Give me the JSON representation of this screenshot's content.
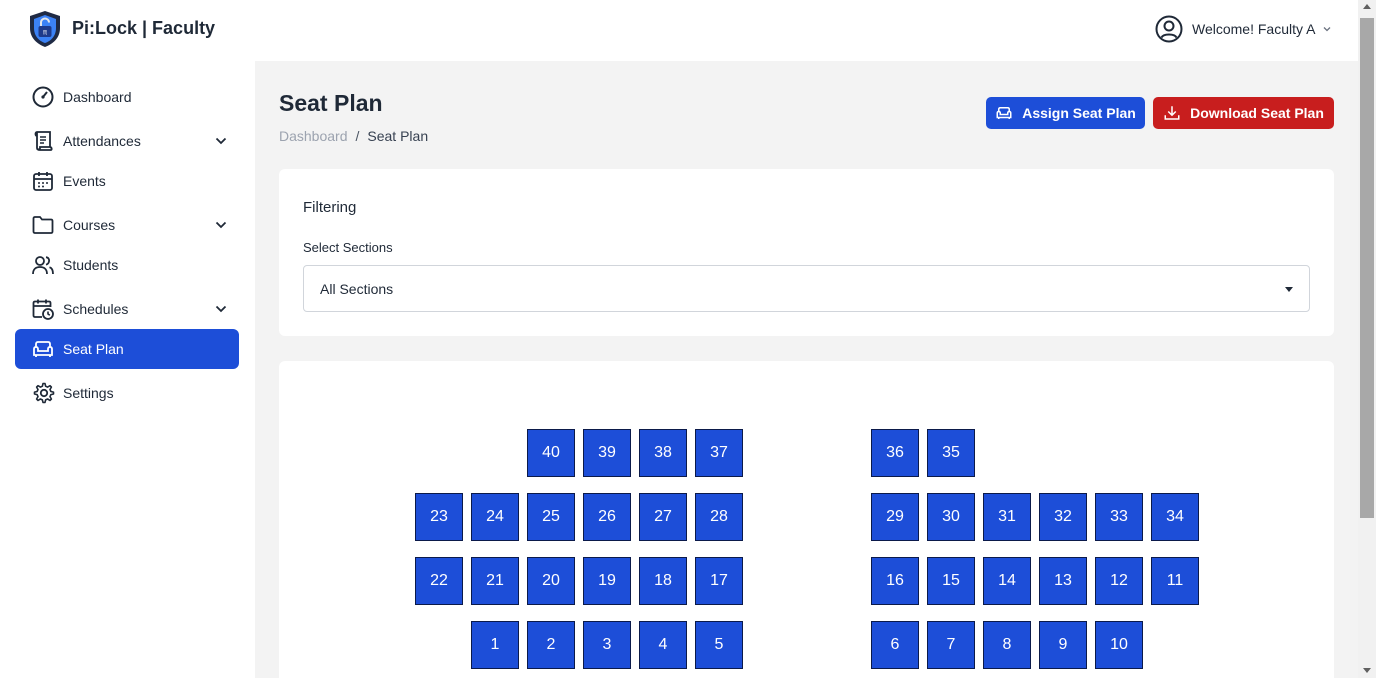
{
  "header": {
    "brand": "Pi:Lock | Faculty",
    "logo_icon": "shield-lock-icon",
    "user_icon": "user-circle-icon",
    "welcome": "Welcome! Faculty A"
  },
  "sidebar": {
    "items": [
      {
        "label": "Dashboard",
        "icon": "dashboard-gauge-icon",
        "expandable": false,
        "active": false
      },
      {
        "label": "Attendances",
        "icon": "scroll-icon",
        "expandable": true,
        "active": false
      },
      {
        "label": "Events",
        "icon": "calendar-icon",
        "expandable": false,
        "active": false
      },
      {
        "label": "Courses",
        "icon": "folder-icon",
        "expandable": true,
        "active": false
      },
      {
        "label": "Students",
        "icon": "users-icon",
        "expandable": false,
        "active": false
      },
      {
        "label": "Schedules",
        "icon": "calendar-clock-icon",
        "expandable": true,
        "active": false
      },
      {
        "label": "Seat Plan",
        "icon": "sofa-icon",
        "expandable": false,
        "active": true
      },
      {
        "label": "Settings",
        "icon": "gear-icon",
        "expandable": false,
        "active": false
      }
    ]
  },
  "page": {
    "title": "Seat Plan",
    "breadcrumb": {
      "parent": "Dashboard",
      "separator": "/",
      "current": "Seat Plan"
    },
    "buttons": {
      "assign": "Assign Seat Plan",
      "download": "Download Seat Plan"
    }
  },
  "filter": {
    "title": "Filtering",
    "label": "Select Sections",
    "selected": "All Sections"
  },
  "seats": {
    "left_rows": [
      [
        "",
        "",
        "40",
        "39",
        "38",
        "37"
      ],
      [
        "23",
        "24",
        "25",
        "26",
        "27",
        "28"
      ],
      [
        "22",
        "21",
        "20",
        "19",
        "18",
        "17"
      ],
      [
        "",
        "1",
        "2",
        "3",
        "4",
        "5"
      ]
    ],
    "right_rows": [
      [
        "36",
        "35",
        "",
        "",
        "",
        ""
      ],
      [
        "29",
        "30",
        "31",
        "32",
        "33",
        "34"
      ],
      [
        "16",
        "15",
        "14",
        "13",
        "12",
        "11"
      ],
      [
        "6",
        "7",
        "8",
        "9",
        "10",
        ""
      ]
    ]
  },
  "colors": {
    "primary": "#1d4ed8",
    "danger": "#c81e1e",
    "background": "#f3f3f3"
  }
}
